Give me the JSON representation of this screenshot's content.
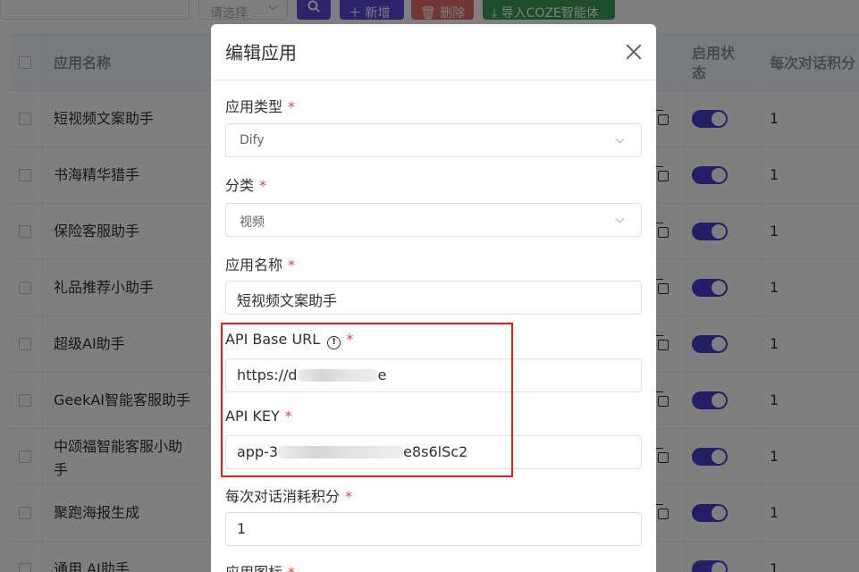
{
  "toolbar": {
    "select_placeholder": "请选择",
    "add_label": "新增",
    "delete_label": "删除",
    "import_label": "导入COZE智能体",
    "search_icon": "search-icon",
    "add_icon": "plus-icon",
    "delete_icon": "trash-icon",
    "import_icon": "download-icon"
  },
  "table": {
    "headers": {
      "name": "应用名称",
      "enabled": "启用状态",
      "points": "每次对话积分"
    },
    "rows": [
      {
        "name": "短视频文案助手",
        "enabled": true,
        "points": "1"
      },
      {
        "name": "书海精华猎手",
        "enabled": true,
        "points": "1"
      },
      {
        "name": "保险客服助手",
        "enabled": true,
        "points": "1"
      },
      {
        "name": "礼品推荐小助手",
        "enabled": true,
        "points": "1"
      },
      {
        "name": "超级AI助手",
        "enabled": true,
        "points": "1"
      },
      {
        "name": "GeekAI智能客服助手",
        "enabled": true,
        "points": "1"
      },
      {
        "name": "中颂福智能客服小助手",
        "enabled": true,
        "points": "1"
      },
      {
        "name": "聚跑海报生成",
        "enabled": true,
        "points": "1"
      },
      {
        "name": "通用 AI助手",
        "enabled": true,
        "points": "1"
      }
    ]
  },
  "dialog": {
    "title": "编辑应用",
    "required_mark": "*",
    "fields": {
      "app_type": {
        "label": "应用类型",
        "value": "Dify"
      },
      "category": {
        "label": "分类",
        "value": "视频"
      },
      "app_name": {
        "label": "应用名称",
        "value": "短视频文案助手"
      },
      "api_base_url": {
        "label": "API Base URL",
        "value_prefix": "https://d",
        "value_suffix": "e"
      },
      "api_key": {
        "label": "API KEY",
        "value_prefix": "app-3",
        "value_suffix": "e8s6lSc2"
      },
      "points_per_chat": {
        "label": "每次对话消耗积分",
        "value": "1"
      },
      "app_icon": {
        "label": "应用图标"
      }
    }
  },
  "colors": {
    "primary": "#5b49d6",
    "danger": "#e26b6b",
    "success": "#3a9a55",
    "switch_on": "#4b3fd0",
    "highlight_box": "#e02020",
    "required_star": "#e04848"
  }
}
